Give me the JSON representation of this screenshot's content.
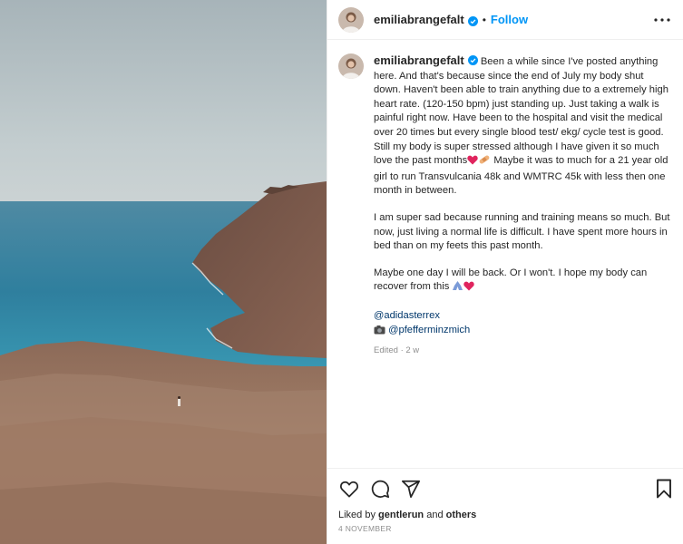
{
  "post": {
    "username": "emiliabrangefalt",
    "follow_label": "Follow",
    "separator": "•",
    "caption": {
      "part1": "Been a while since I've posted anything here. And that's because since the end of July my body shut down. Haven't been able to train anything due to a extremely high heart rate. (120-150 bpm) just standing up. Just taking a walk is painful right now. Have been to the hospital and visit the medical over 20 times but every single blood test/ ekg/ cycle test is good. Still my body is super stressed although I have given it so much love the past months",
      "part2": " Maybe it was to much for a 21 year old girl to run Transvulcania 48k and WMTRC 45k with less then one month in between.",
      "paragraph2": "I am super sad because running and training means so much. But now, just living a normal life is difficult. I have spent more hours in bed than on my feets this past month.",
      "paragraph3": "Maybe one day I will be back. Or I won't. I hope my body can recover from this ",
      "mention_brand": "@adidasterrex",
      "mention_photographer": "@pfefferminzmich"
    },
    "meta": "Edited · 2 w",
    "likes_prefix": "Liked by ",
    "likes_user": "gentlerun",
    "likes_and": " and ",
    "likes_others": "others",
    "date": "4 NOVEMBER"
  },
  "icons": {
    "like": "heart-icon",
    "comment": "comment-icon",
    "share": "share-icon",
    "save": "bookmark-icon",
    "more": "more-options-icon",
    "verified": "verified-badge-icon",
    "camera": "camera-emoji"
  },
  "colors": {
    "follow": "#0095f6",
    "mention": "#00376b",
    "verified": "#0095f6",
    "muted": "#8e8e8e"
  }
}
